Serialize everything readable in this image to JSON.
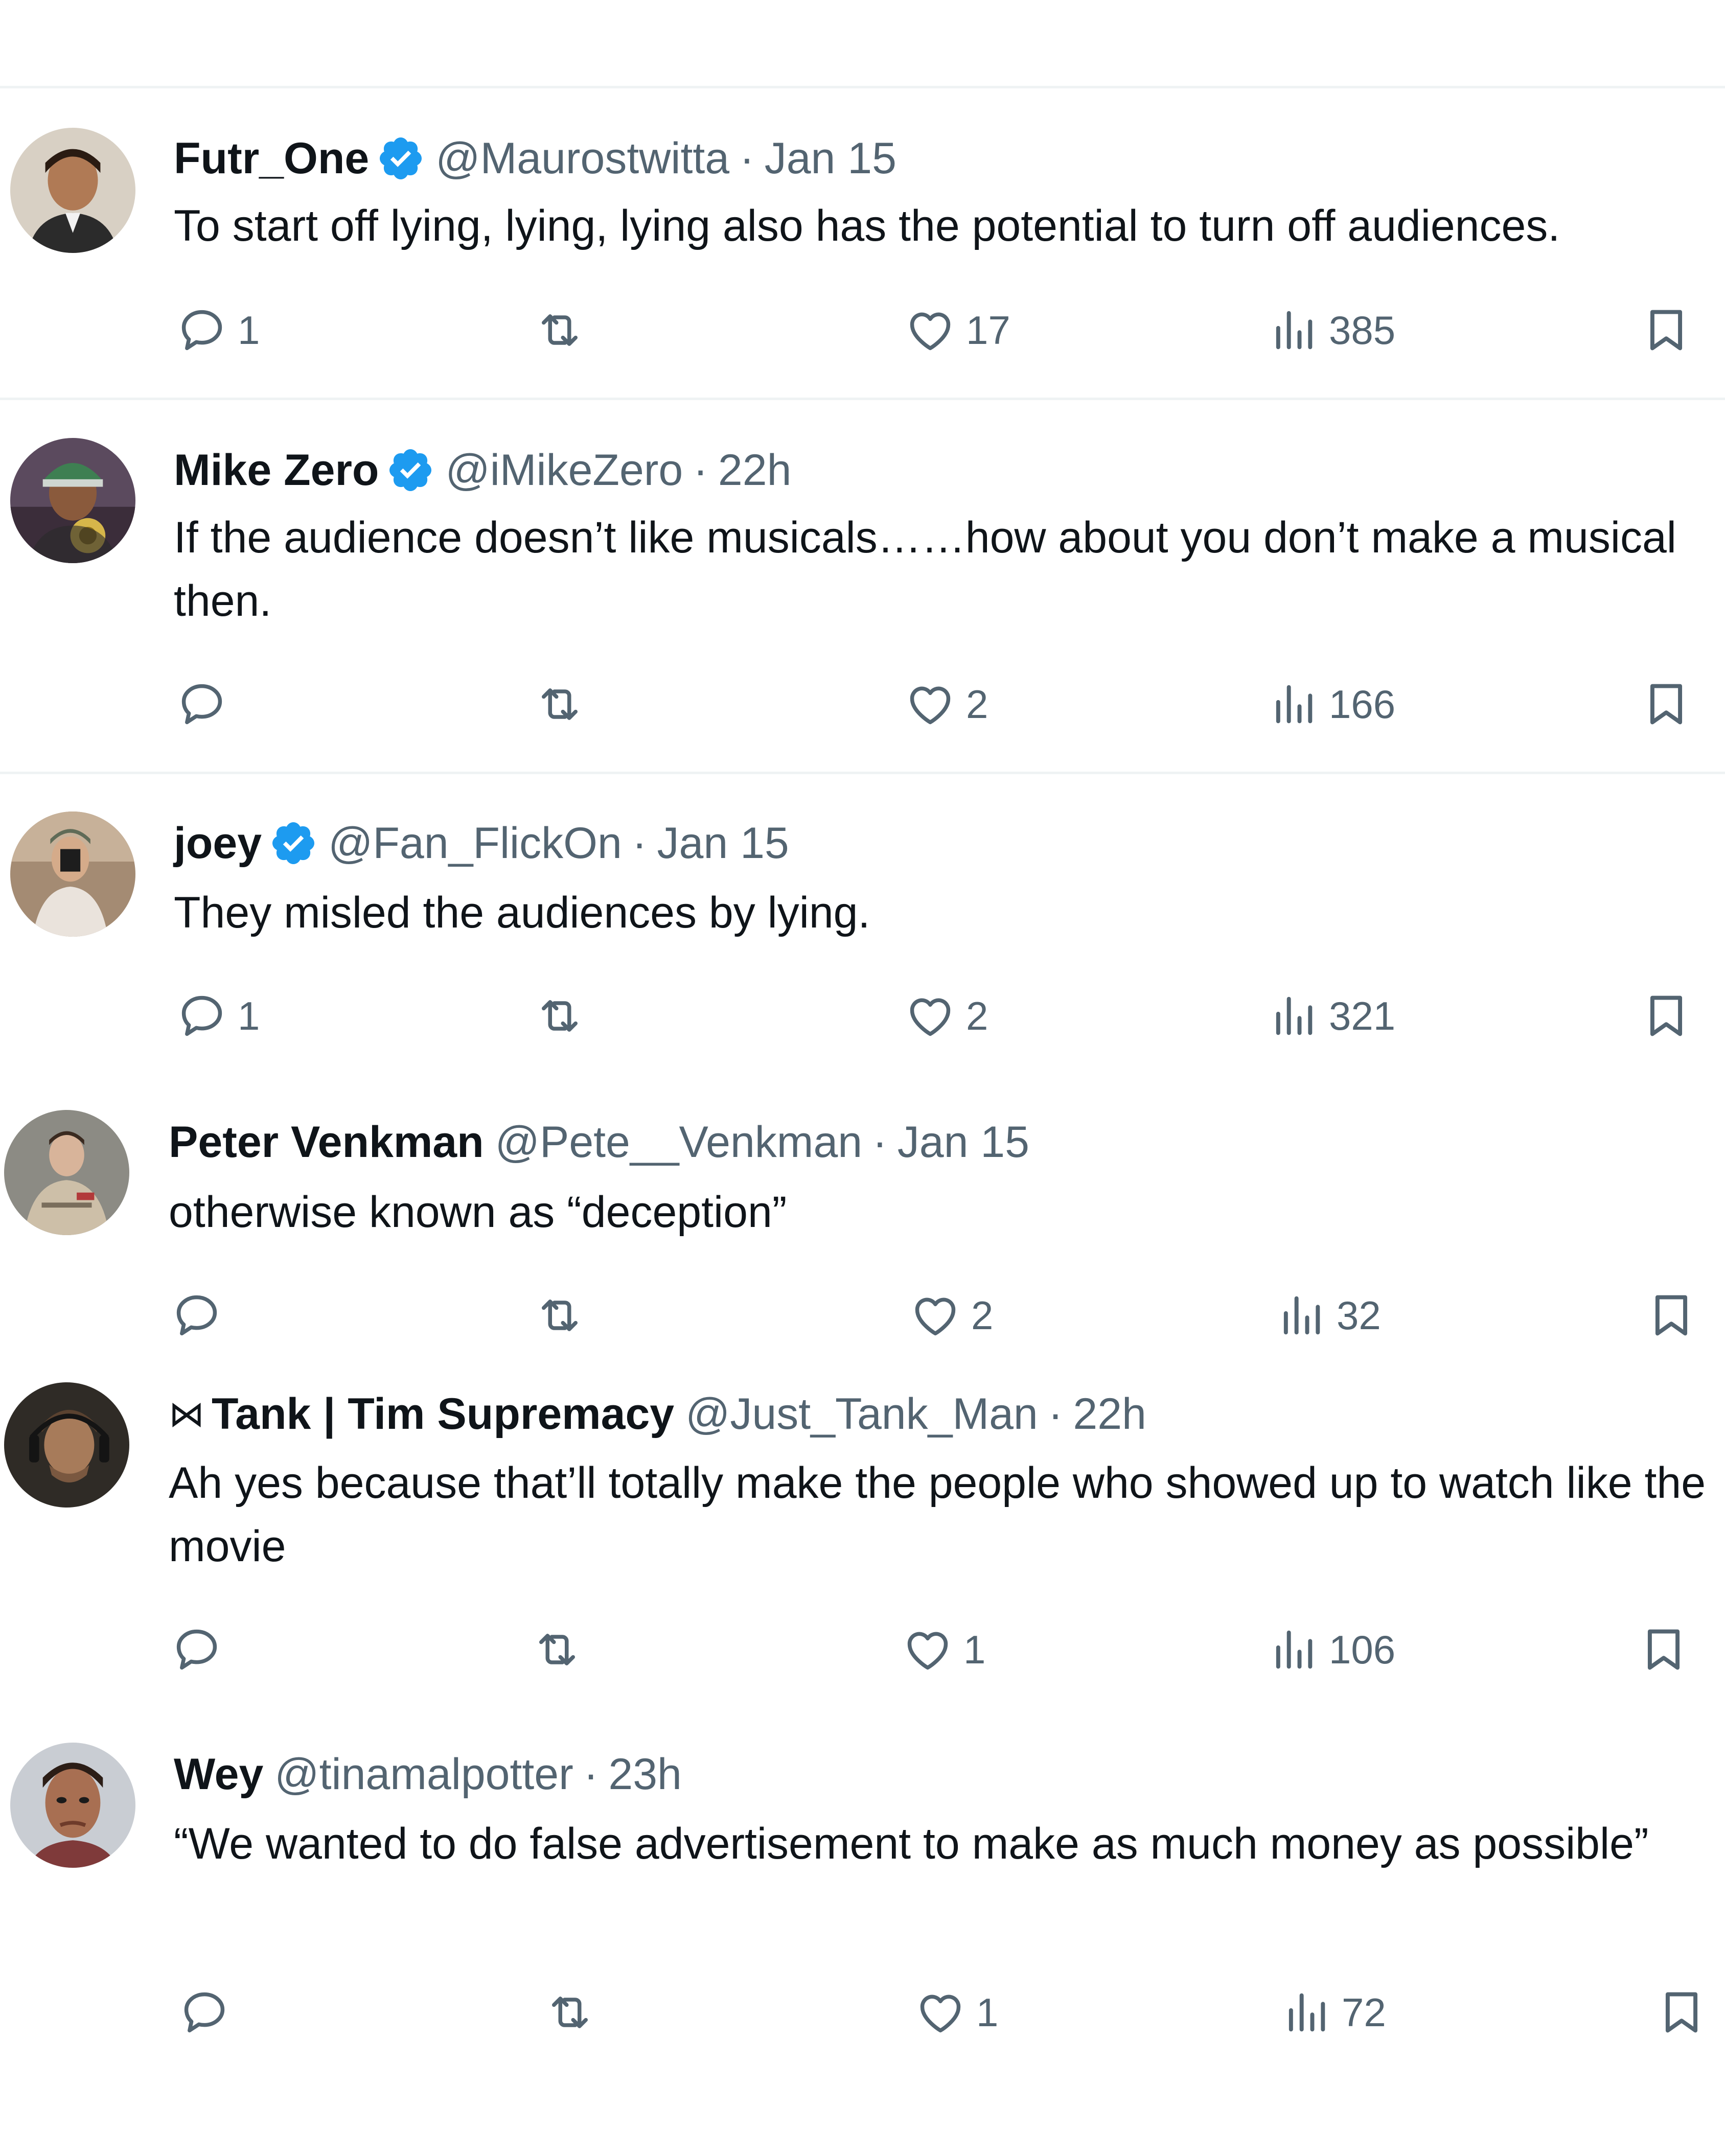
{
  "colors": {
    "text": "#0f1419",
    "secondary": "#536471",
    "verified": "#1d9bf0",
    "divider": "#eff3f4"
  },
  "icons": {
    "reply": "speech-bubble-icon",
    "repost": "retweet-arrows-icon",
    "like": "heart-icon",
    "views": "bar-chart-icon",
    "bookmark": "bookmark-icon",
    "verified": "verified-badge-icon"
  },
  "tweets": [
    {
      "name": "Futr_One",
      "verified": true,
      "handle": "@Maurostwitta",
      "separator": "·",
      "time": "Jan 15",
      "text": "To start off lying, lying, lying also has the potential to turn off audiences.",
      "replies": "1",
      "reposts": "",
      "likes": "17",
      "views": "385"
    },
    {
      "name": "Mike Zero",
      "verified": true,
      "handle": "@iMikeZero",
      "separator": "·",
      "time": "22h",
      "text": "If the audience doesn’t like musicals……how about you don’t make a musical then.",
      "replies": "",
      "reposts": "",
      "likes": "2",
      "views": "166"
    },
    {
      "name": "joey",
      "verified": true,
      "handle": "@Fan_FlickOn",
      "separator": "·",
      "time": "Jan 15",
      "text": "They misled the audiences by lying.",
      "replies": "1",
      "reposts": "",
      "likes": "2",
      "views": "321"
    },
    {
      "name": "Peter Venkman",
      "verified": false,
      "handle": "@Pete__Venkman",
      "separator": "·",
      "time": "Jan 15",
      "text": "otherwise known as “deception”",
      "replies": "",
      "reposts": "",
      "likes": "2",
      "views": "32"
    },
    {
      "name_prefix": "⋈",
      "name": "Tank | Tim Supremacy",
      "verified": false,
      "handle": "@Just_Tank_Man",
      "separator": "·",
      "time": "22h",
      "text": "Ah yes because that’ll totally make the people who showed up to watch like the movie",
      "replies": "",
      "reposts": "",
      "likes": "1",
      "views": "106"
    },
    {
      "name": "Wey",
      "verified": false,
      "handle": "@tinamalpotter",
      "separator": "·",
      "time": "23h",
      "text": "“We wanted to do false advertisement to make as much money as possible”",
      "replies": "",
      "reposts": "",
      "likes": "1",
      "views": "72"
    }
  ]
}
